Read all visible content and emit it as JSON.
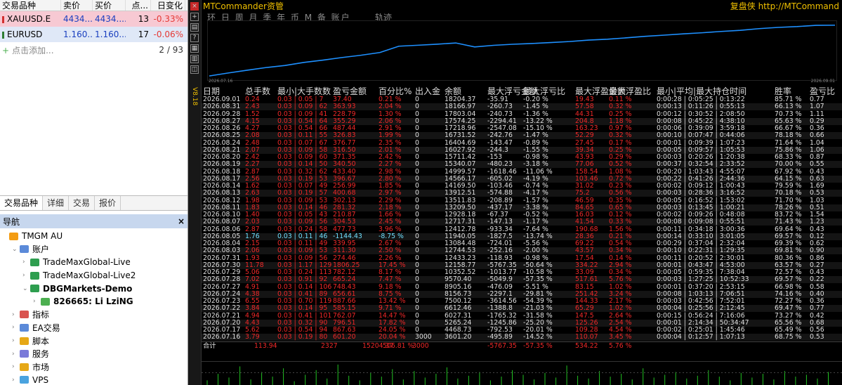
{
  "market_watch": {
    "headers": [
      "交易品种",
      "卖价",
      "买价",
      "点...",
      "日变化"
    ],
    "rows": [
      {
        "symbol": "XAUUSD.E",
        "bid": "4434....",
        "ask": "4434....",
        "spread": "13",
        "change": "-0.33%",
        "change_color": "#e53935"
      },
      {
        "symbol": "EURUSD",
        "bid": "1.160....",
        "ask": "1.160....",
        "spread": "17",
        "change": "-0.06%",
        "change_color": "#e53935"
      }
    ],
    "add_label": "点击添加...",
    "count": "2 / 93"
  },
  "bottom_tabs": [
    "交易品种",
    "详细",
    "交易",
    "报价"
  ],
  "navigator": {
    "title": "导航",
    "close": "×",
    "items": [
      {
        "label": "TMGM AU",
        "icon": "broker-icon",
        "indent": 0,
        "bold": false
      },
      {
        "label": "账户",
        "icon": "accounts-icon",
        "indent": 1,
        "bold": false
      },
      {
        "label": "TradeMaxGlobal-Live",
        "icon": "server-icon",
        "indent": 2,
        "bold": false
      },
      {
        "label": "TradeMaxGlobal-Live2",
        "icon": "server-icon",
        "indent": 2,
        "bold": false
      },
      {
        "label": "DBGMarkets-Demo",
        "icon": "server-icon",
        "indent": 2,
        "bold": true
      },
      {
        "label": "826665: Li LziNG",
        "icon": "user-icon",
        "indent": 3,
        "bold": true
      },
      {
        "label": "指标",
        "icon": "indicator-icon",
        "indent": 1,
        "bold": false
      },
      {
        "label": "EA交易",
        "icon": "ea-icon",
        "indent": 1,
        "bold": false
      },
      {
        "label": "脚本",
        "icon": "script-icon",
        "indent": 1,
        "bold": false
      },
      {
        "label": "服务",
        "icon": "service-icon",
        "indent": 1,
        "bold": false
      },
      {
        "label": "市场",
        "icon": "market-icon",
        "indent": 1,
        "bold": false
      },
      {
        "label": "VPS",
        "icon": "vps-icon",
        "indent": 1,
        "bold": false
      }
    ]
  },
  "chart": {
    "title": "MTCommander资管",
    "right_label": "复盘侠 http://MTCommand",
    "period_tabs": "环 日 周 月 季 年 币 M 备 账户",
    "track_label": "轨迹",
    "equity_start_date": "2026.07.16",
    "equity_end_date": "2026.09.01",
    "vertical_label": "V8.18",
    "colors": {
      "title": "#f0c000",
      "red": "#f02828",
      "cyan": "#70e0ff",
      "curve": "#1e90ff"
    }
  },
  "stats_table": {
    "headers": [
      "日期",
      "总手数",
      "最小|大手数数",
      "盈亏金额",
      "百分比%",
      "出入金",
      "余额",
      "最大浮亏金额",
      "最大浮亏比",
      "最大浮盈金额",
      "最大浮盈比",
      "最小|平均|最大持仓时间",
      "胜率",
      "盈亏比"
    ],
    "rows": [
      [
        "2026.09.01",
        "0.24",
        "0.03 | 0.05 | 7",
        "37.40",
        "0.21 %",
        "0",
        "18204.37",
        "-35.91",
        "-0.20 %",
        "19.43",
        "0.11 %",
        "0:00:28 | 0:05:25 | 0:13:22",
        "85.71 %",
        "0.77"
      ],
      [
        "2026.08.31",
        "2.43",
        "0.03 | 0.09 | 62",
        "363.93",
        "2.04 %",
        "0",
        "18166.97",
        "-260.73",
        "-1.45 %",
        "57.58",
        "0.32 %",
        "0:00:13 | 0:11:26 | 0:55:13",
        "66.13 %",
        "1.07"
      ],
      [
        "2026.09.28",
        "1.52",
        "0.03 | 0.09 | 41",
        "228.79",
        "1.30 %",
        "0",
        "17803.04",
        "-240.73",
        "-1.36 %",
        "44.31",
        "0.25 %",
        "0:00:12 | 0:30:52 | 2:08:50",
        "70.73 %",
        "1.11"
      ],
      [
        "2026.08.27",
        "4.15",
        "0.03 | 0.54 | 64",
        "355.29",
        "2.06 %",
        "0",
        "17574.25",
        "-2294.41",
        "-13.22 %",
        "204.8",
        "1.18 %",
        "0:00:08 | 0:45:22 | 4:38:10",
        "65.63 %",
        "0.29"
      ],
      [
        "2026.08.26",
        "4.27",
        "0.03 | 0.54 | 66",
        "487.44",
        "2.91 %",
        "0",
        "17218.96",
        "-2547.08",
        "-15.10 %",
        "163.23",
        "0.97 %",
        "0:00:06 | 0:39:09 | 3:59:18",
        "66.67 %",
        "0.36"
      ],
      [
        "2026.08.25",
        "2.08",
        "0.03 | 0.11 | 55",
        "326.83",
        "1.99 %",
        "0",
        "16731.52",
        "-242.76",
        "-1.47 %",
        "52.29",
        "0.32 %",
        "0:00:10 | 0:07:47 | 0:44:06",
        "78.18 %",
        "0.66"
      ],
      [
        "2026.08.24",
        "2.48",
        "0.03 | 0.07 | 67",
        "376.77",
        "2.35 %",
        "0",
        "16404.69",
        "-143.47",
        "-0.89 %",
        "27.45",
        "0.17 %",
        "0:00:01 | 0:09:39 | 1:07:23",
        "71.64 %",
        "1.04"
      ],
      [
        "2026.08.21",
        "2.07",
        "0.03 | 0.09 | 58",
        "316.50",
        "2.01 %",
        "0",
        "16027.92",
        "-244.3",
        "-1.55 %",
        "39.34",
        "0.25 %",
        "0:00:05 | 0:09:57 | 1:05:53",
        "75.86 %",
        "1.06"
      ],
      [
        "2026.08.20",
        "2.42",
        "0.03 | 0.09 | 60",
        "371.35",
        "2.42 %",
        "0",
        "15711.42",
        "-153",
        "-0.98 %",
        "43.93",
        "0.29 %",
        "0:00:03 | 0:20:26 | 1:20:38",
        "68.33 %",
        "0.87"
      ],
      [
        "2026.08.19",
        "2.27",
        "0.03 | 0.14 | 50",
        "340.50",
        "2.27 %",
        "0",
        "15340.07",
        "-480.23",
        "-3.18 %",
        "77.06",
        "0.52 %",
        "0:00:37 | 0:32:54 | 2:33:52",
        "70.00 %",
        "0.55"
      ],
      [
        "2026.08.18",
        "2.87",
        "0.03 | 0.32 | 62",
        "433.40",
        "2.98 %",
        "0",
        "14999.57",
        "-1618.46",
        "-11.06 %",
        "158.54",
        "1.08 %",
        "0:00:20 | 1:03:43 | 4:55:07",
        "67.92 %",
        "0.43"
      ],
      [
        "2026.08.17",
        "2.56",
        "0.03 | 0.19 | 53",
        "396.67",
        "2.80 %",
        "0",
        "14566.17",
        "-605.02",
        "-4.19 %",
        "103.46",
        "0.72 %",
        "0:00:22 | 0:41:26 | 2:44:36",
        "64.15 %",
        "0.63"
      ],
      [
        "2026.08.14",
        "1.62",
        "0.03 | 0.07 | 49",
        "256.99",
        "1.85 %",
        "0",
        "14169.50",
        "-103.46",
        "-0.74 %",
        "31.02",
        "0.23 %",
        "0:00:02 | 0:09:12 | 1:00:43",
        "79.59 %",
        "1.69"
      ],
      [
        "2026.08.13",
        "2.63",
        "0.03 | 0.19 | 57",
        "400.68",
        "2.97 %",
        "0",
        "13912.51",
        "-574.88",
        "-4.17 %",
        "75.2",
        "0.56 %",
        "0:00:03 | 0:28:36 | 3:16:52",
        "70.18 %",
        "0.53"
      ],
      [
        "2026.08.12",
        "1.98",
        "0.03 | 0.09 | 53",
        "302.13",
        "2.29 %",
        "0",
        "13511.83",
        "-208.89",
        "-1.57 %",
        "46.59",
        "0.35 %",
        "0:00:05 | 0:16:52 | 1:53:02",
        "71.70 %",
        "1.03"
      ],
      [
        "2026.08.11",
        "1.83",
        "0.03 | 0.14 | 46",
        "281.32",
        "2.18 %",
        "0",
        "13209.50",
        "-437.17",
        "-3.38 %",
        "84.65",
        "0.65 %",
        "0:00:03 | 0:13:45 | 1:00:21",
        "78.26 %",
        "0.51"
      ],
      [
        "2026.08.10",
        "1.40",
        "0.03 | 0.05 | 43",
        "210.87",
        "1.66 %",
        "0",
        "12928.18",
        "-67.37",
        "-0.52 %",
        "16.03",
        "0.12 %",
        "0:00:02 | 0:09:26 | 0:48:08",
        "83.72 %",
        "1.54"
      ],
      [
        "2026.08.07",
        "2.03",
        "0.03 | 0.09 | 56",
        "304.53",
        "2.45 %",
        "0",
        "12717.31",
        "-147.13",
        "-1.17 %",
        "41.54",
        "0.33 %",
        "0:00:08 | 0:09:08 | 0:55:51",
        "71.43 %",
        "1.23"
      ],
      [
        "2026.08.06",
        "2.87",
        "0.03 | 0.24 | 58",
        "477.73",
        "3.96 %",
        "0",
        "12412.78",
        "-933.34",
        "-7.64 %",
        "190.68",
        "1.56 %",
        "0:00:11 | 0:34:18 | 3:00:36",
        "69.64 %",
        "0.43"
      ],
      [
        "2026.08.05",
        "1.76",
        "0.03 | 0.11 | 46",
        "-1144.43",
        "-8.75 %",
        "0",
        "11940.05",
        "-1827.5",
        "-13.74 %",
        "28.36",
        "0.21 %",
        "0:00:14 | 0:33:10 | 3:01:05",
        "69.57 %",
        "0.12"
      ],
      [
        "2026.08.04",
        "2.15",
        "0.03 | 0.11 | 49",
        "339.95",
        "2.67 %",
        "0",
        "13084.48",
        "-724.01",
        "-5.56 %",
        "69.22",
        "0.54 %",
        "0:00:29 | 0:37:04 | 2:32:04",
        "69.39 %",
        "0.62"
      ],
      [
        "2026.08.03",
        "2.06",
        "0.03 | 0.09 | 53",
        "311.30",
        "2.50 %",
        "0",
        "12744.53",
        "-252.16",
        "-2.00 %",
        "43.57",
        "0.34 %",
        "0:00:10 | 0:22:31 | 1:29:35",
        "69.81 %",
        "0.90"
      ],
      [
        "2026.07.31",
        "1.93",
        "0.03 | 0.09 | 56",
        "274.46",
        "2.26 %",
        "0",
        "12433.23",
        "-118.93",
        "-0.98 %",
        "17.54",
        "0.14 %",
        "0:00:11 | 0:20:52 | 2:30:01",
        "80.36 %",
        "0.86"
      ],
      [
        "2026.07.30",
        "11.78",
        "0.03 | 1.17 | 129",
        "1806.25",
        "17.45 %",
        "0",
        "12158.77",
        "-5767.35",
        "-50.64 %",
        "334.22",
        "2.94 %",
        "0:00:01 | 0:43:47 | 4:53:00",
        "63.57 %",
        "0.27"
      ],
      [
        "2026.07.29",
        "5.06",
        "0.03 | 0.24 | 113",
        "782.12",
        "8.17 %",
        "0",
        "10352.52",
        "-1013.77",
        "-10.58 %",
        "33.09",
        "0.34 %",
        "0:00:05 | 0:59:35 | 7:38:04",
        "72.57 %",
        "0.43"
      ],
      [
        "2026.07.28",
        "7.02",
        "0.03 | 0.91 | 92",
        "665.24",
        "7.47 %",
        "0",
        "9570.40",
        "-5049.9",
        "-57.35 %",
        "517.61",
        "5.76 %",
        "0:00:03 | 1:27:25 | 10:52:33",
        "69.57 %",
        "0.22"
      ],
      [
        "2026.07.27",
        "4.91",
        "0.03 | 0.14 | 106",
        "748.43",
        "9.18 %",
        "0",
        "8905.16",
        "-476.09",
        "-5.51 %",
        "83.15",
        "1.02 %",
        "0:00:01 | 0:37:20 | 2:53:15",
        "66.98 %",
        "0.58"
      ],
      [
        "2026.07.24",
        "4.38",
        "0.03 | 0.41 | 89",
        "656.61",
        "8.75 %",
        "0",
        "8156.73",
        "-2297.1",
        "-29.81 %",
        "251.42",
        "3.24 %",
        "0:00:08 | 1:03:13 | 7:06:51",
        "74.16 %",
        "0.40"
      ],
      [
        "2026.07.23",
        "6.55",
        "0.03 | 0.70 | 119",
        "887.66",
        "13.42 %",
        "0",
        "7500.12",
        "-3614.56",
        "-54.39 %",
        "144.33",
        "2.17 %",
        "0:00:03 | 0:42:56 | 7:52:01",
        "72.27 %",
        "0.36"
      ],
      [
        "2026.07.22",
        "3.84",
        "0.03 | 0.14 | 95",
        "585.15",
        "9.71 %",
        "0",
        "6612.46",
        "-1388.8",
        "-21.03 %",
        "65.29",
        "1.02 %",
        "0:00:04 | 0:25:56 | 2:12:45",
        "69.47 %",
        "0.77"
      ],
      [
        "2026.07.21",
        "4.94",
        "0.03 | 0.41 | 101",
        "762.07",
        "14.47 %",
        "0",
        "6027.31",
        "-1765.32",
        "-31.58 %",
        "147.5",
        "2.64 %",
        "0:00:15 | 0:56:24 | 7:16:06",
        "73.27 %",
        "0.42"
      ],
      [
        "2026.07.20",
        "4.43",
        "0.03 | 0.32 | 90",
        "796.51",
        "17.82 %",
        "0",
        "5265.24",
        "-1245.86",
        "-25.20 %",
        "125.26",
        "2.54 %",
        "0:00:01 | 2:14:34 | 50:34:47",
        "65.56 %",
        "0.68"
      ],
      [
        "2026.07.17",
        "5.62",
        "0.03 | 0.54 | 94",
        "867.63",
        "24.05 %",
        "0",
        "4468.73",
        "-792.53",
        "-20.01 %",
        "109.28",
        "4.54 %",
        "0:00:02 | 0:25:01 | 1:45:46",
        "65.49 %",
        "0.56"
      ],
      [
        "2026.07.16",
        "3.79",
        "0.03 | 0.19 | 80",
        "601.20",
        "20.04 %",
        "3000",
        "3601.20",
        "-495.89",
        "-14.52 %",
        "110.07",
        "3.45 %",
        "0:00:04 | 0:12:57 | 1:07:13",
        "68.75 %",
        "0.53"
      ]
    ],
    "summary": [
      "合计",
      "113.94",
      "",
      "2327",
      "15204.37",
      "506.81 %",
      "3000",
      "",
      "-5767.35",
      "-57.35 %",
      "534.22",
      "5.76 %"
    ]
  },
  "equity_curve": [
    3601.2,
    4468.73,
    5265.24,
    6027.31,
    6612.46,
    7500.12,
    8156.73,
    8905.16,
    9570.4,
    10352.52,
    12158.77,
    12433.23,
    12744.53,
    13084.48,
    11940.05,
    12412.78,
    12717.31,
    12928.18,
    13209.5,
    13511.83,
    13912.51,
    14169.5,
    14566.17,
    14999.57,
    15340.07,
    15711.42,
    16027.92,
    16404.69,
    16731.52,
    17218.96,
    17574.25,
    17803.04,
    18166.97,
    18204.37
  ],
  "volume_bars": [
    5,
    12,
    8,
    20,
    6,
    14,
    9,
    18,
    4,
    11,
    16,
    7,
    22,
    10,
    5,
    13,
    9,
    17,
    6,
    15,
    8,
    12,
    19,
    7,
    10,
    14,
    5,
    9,
    16,
    11,
    6,
    13,
    8,
    21,
    10,
    7,
    15,
    9,
    12,
    6,
    18,
    8,
    11,
    14,
    7,
    10,
    16,
    9,
    5,
    13,
    8,
    12,
    6,
    15,
    9,
    11,
    7,
    14
  ]
}
